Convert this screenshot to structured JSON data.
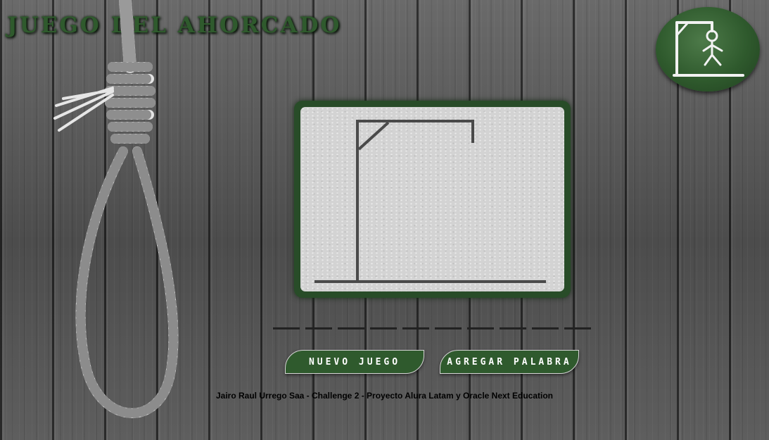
{
  "header": {
    "title": "JUEGO DEL AHORCADO",
    "logo_icon": "hangman-stick-figure-icon"
  },
  "decoration": {
    "rope_icon": "noose-rope-icon"
  },
  "board": {
    "gallows_icon": "gallows-icon",
    "errors_shown": 0
  },
  "word": {
    "hidden_letters": 10,
    "revealed": [
      "",
      "",
      "",
      "",
      "",
      "",
      "",
      "",
      "",
      ""
    ]
  },
  "actions": {
    "new_game_label": "NUEVO JUEGO",
    "add_word_label": "AGREGAR PALABRA"
  },
  "footer": {
    "credits": "Jairo Raul Urrego Saa - Challenge 2 - Proyecto Alura Latam y Oracle Next Education"
  },
  "colors": {
    "accent_green": "#2f5a2d",
    "board_bg": "#d3d3d3",
    "gallows": "#4a4a4a"
  }
}
